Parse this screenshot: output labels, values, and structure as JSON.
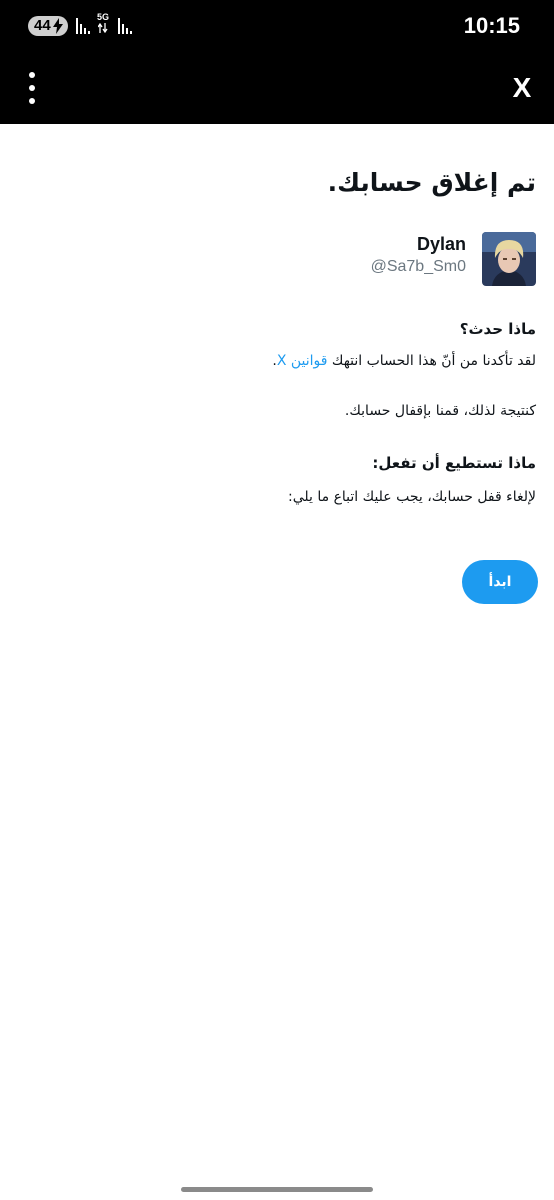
{
  "status_bar": {
    "battery": "44",
    "network": "5G",
    "time": "10:15"
  },
  "app_bar": {
    "close_label": "X",
    "more_icon": "more-vertical-icon"
  },
  "notice": {
    "title": "تم إغلاق حسابك.",
    "account": {
      "name": "Dylan",
      "handle": "@Sa7b_Sm0"
    },
    "what_happened": {
      "heading": "ماذا حدث؟",
      "text_before": "لقد تأكدنا من أنّ هذا الحساب انتهك ",
      "link": "قوانين X",
      "text_after": ".",
      "consequence": "كنتيجة لذلك، قمنا بإقفال حسابك."
    },
    "what_to_do": {
      "heading": "ماذا تستطيع أن تفعل:",
      "text": "لإلغاء قفل حسابك، يجب عليك اتباع ما يلي:"
    },
    "start_button": "ابدأ"
  },
  "colors": {
    "accent": "#1d9bf0",
    "text": "#0f1419",
    "muted": "#6b7780",
    "bar": "#000000"
  }
}
